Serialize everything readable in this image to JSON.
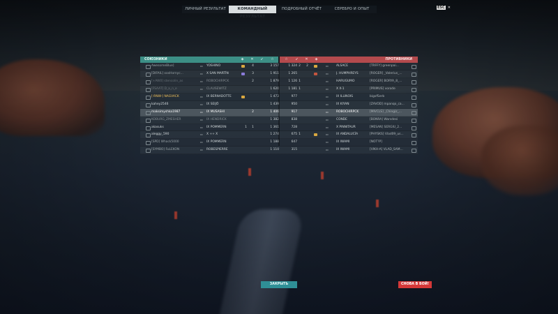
{
  "tabs": [
    {
      "label": "ЛИЧНЫЙ РЕЗУЛЬТАТ",
      "active": false
    },
    {
      "label": "КОМАНДНЫЙ РЕЗУЛЬТАТ",
      "active": true
    },
    {
      "label": "ПОДРОБНЫЙ ОТЧЁТ",
      "active": false
    },
    {
      "label": "СЕРЕБРО И ОПЫТ",
      "active": false
    }
  ],
  "corner": {
    "key": "ESC",
    "icon": "close-icon"
  },
  "allies_header": "СОЮЗНИКИ",
  "enemies_header": "ПРОТИВНИКИ",
  "colors": {
    "allies": "#3c8f86",
    "enemies": "#b44a4d",
    "close_button": "#2f8f96",
    "again_button": "#d43838"
  },
  "allies": [
    {
      "player": "AwesomeBlue]",
      "ship": "YOSHINO",
      "k2": "",
      "k1": "4",
      "dmg": "3 157",
      "exp": "1 324",
      "badge": "#d9a840",
      "clan": true
    },
    {
      "player": "[DIFAIL] xxxHornyc...",
      "ship": "X SAN MARTÍN",
      "k2": "",
      "k1": "3",
      "dmg": "1 911",
      "exp": "1 265",
      "badge": "#8a7bd9",
      "clan": true
    },
    {
      "player": "[+AW0] stencolin_as",
      "ship": "ROBOCHIRPCK",
      "k2": "",
      "k1": "2",
      "dmg": "1 879",
      "exp": "1 126",
      "badge": "",
      "clan": true,
      "dead": true
    },
    {
      "player": "[FSAAT] D_a_n_e",
      "ship": "CLAUSEWITZ",
      "k2": "",
      "k1": "",
      "dmg": "1 620",
      "exp": "1 181",
      "badge": "",
      "clan": true,
      "dead": true
    },
    {
      "player": "[-RNW-] NAGVACK",
      "ship": "IX BERNADOTTE",
      "k2": "",
      "k1": "",
      "dmg": "1 473",
      "exp": "977",
      "badge": "#d9a840",
      "gold": true
    },
    {
      "player": "kahey2546",
      "ship": "IX SEIJŌ",
      "k2": "",
      "k1": "",
      "dmg": "1 439",
      "exp": "950",
      "badge": ""
    },
    {
      "player": "maksimyshka1987",
      "ship": "IX MUSASHI",
      "k2": "",
      "k1": "2",
      "dmg": "1 406",
      "exp": "917",
      "badge": "",
      "me": true
    },
    {
      "player": "KOBURG_ZMESHER",
      "ship": "IX HENDRICK",
      "k2": "",
      "k1": "",
      "dmg": "1 382",
      "exp": "838",
      "badge": "",
      "dead": true
    },
    {
      "player": "akasuks",
      "ship": "IX POMMERN",
      "k2": "1",
      "k1": "1",
      "dmg": "1 361",
      "exp": "728",
      "badge": ""
    },
    {
      "player": "aleggy_590",
      "ship": "X ++ X",
      "k2": "",
      "k1": "",
      "dmg": "1 274",
      "exp": "675",
      "badge": ""
    },
    {
      "player": "[SPD] Whack5000",
      "ship": "IX POMMERN",
      "k2": "",
      "k1": "",
      "dmg": "1 188",
      "exp": "647",
      "badge": "",
      "clan": true
    },
    {
      "player": "[SYMBO] FuLEKON",
      "ship": "ROBESPIERRE",
      "k2": "",
      "k1": "",
      "dmg": "1 110",
      "exp": "315",
      "badge": "",
      "clan": true
    }
  ],
  "enemies": [
    {
      "k": "2",
      "k2": "2",
      "badge": "#d9a840",
      "ship": "ALSACE",
      "player": "[TRFFY] greenpai..."
    },
    {
      "k": "",
      "k2": "",
      "badge": "#c4563f",
      "ship": "J. HUMPHREYS",
      "player": "[ROGER] _Valerius_..."
    },
    {
      "k": "1",
      "k2": "",
      "badge": "",
      "ship": "HARUGUMO",
      "player": "[ROGER] BORYA_8_..."
    },
    {
      "k": "1",
      "k2": "",
      "badge": "",
      "ship": "X X-1",
      "player": "[PRIMUS] vorode"
    },
    {
      "k": "",
      "k2": "",
      "badge": "",
      "ship": "IX ILLINOIS",
      "player": "bigofSerb"
    },
    {
      "k": "",
      "k2": "",
      "badge": "",
      "ship": "IX KIYAN",
      "player": "[ZAVOD] mpanqo_ca..."
    },
    {
      "k": "",
      "k2": "",
      "badge": "",
      "ship": "ROBOCHIRPCK",
      "player": "[MIVCLS] _Chingiz_..."
    },
    {
      "k": "",
      "k2": "",
      "badge": "",
      "ship": "CONDE",
      "player": "[BONRA] Warsdesi"
    },
    {
      "k": "",
      "k2": "",
      "badge": "",
      "ship": "X PINNITAUR",
      "player": "[MESAN] SERGIU_2..."
    },
    {
      "k": "1",
      "k2": "",
      "badge": "#d9a840",
      "ship": "IX ANDALUCÍA",
      "player": "[PHYSKS] Vlad09_us..."
    },
    {
      "k": "",
      "k2": "",
      "badge": "",
      "ship": "IX IWAMI",
      "player": "[NOT?P]"
    },
    {
      "k": "",
      "k2": "",
      "badge": "",
      "ship": "IX IWAMI",
      "player": "[VIKH-A] VLAD_SAM..."
    }
  ],
  "buttons": {
    "close": "ЗАКРЫТЬ",
    "again": "СНОВА В БОЙ!"
  }
}
